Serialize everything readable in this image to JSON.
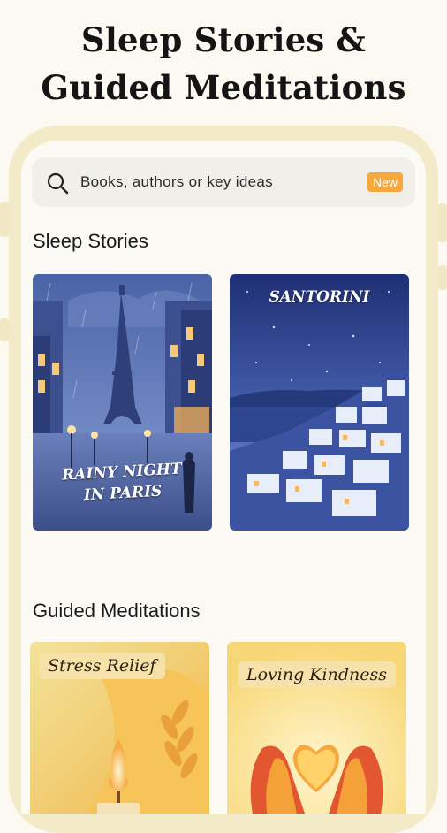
{
  "headline": {
    "line1": "Sleep Stories &",
    "line2": "Guided Meditations"
  },
  "search": {
    "placeholder": "Books, authors or key ideas",
    "badge": "New",
    "icon": "search-icon"
  },
  "sleep_stories": {
    "title": "Sleep Stories",
    "items": [
      {
        "label_line1": "RAINY NIGHT",
        "label_line2": "IN PARIS"
      },
      {
        "label": "SANTORINI"
      }
    ]
  },
  "guided_meditations": {
    "title": "Guided Meditations",
    "items": [
      {
        "label": "Stress Relief"
      },
      {
        "label": "Loving Kindness"
      }
    ]
  },
  "colors": {
    "background": "#fbf9f1",
    "phone_frame": "#f3ebc8",
    "badge": "#f6a83c",
    "search_bg": "#f0efea"
  }
}
